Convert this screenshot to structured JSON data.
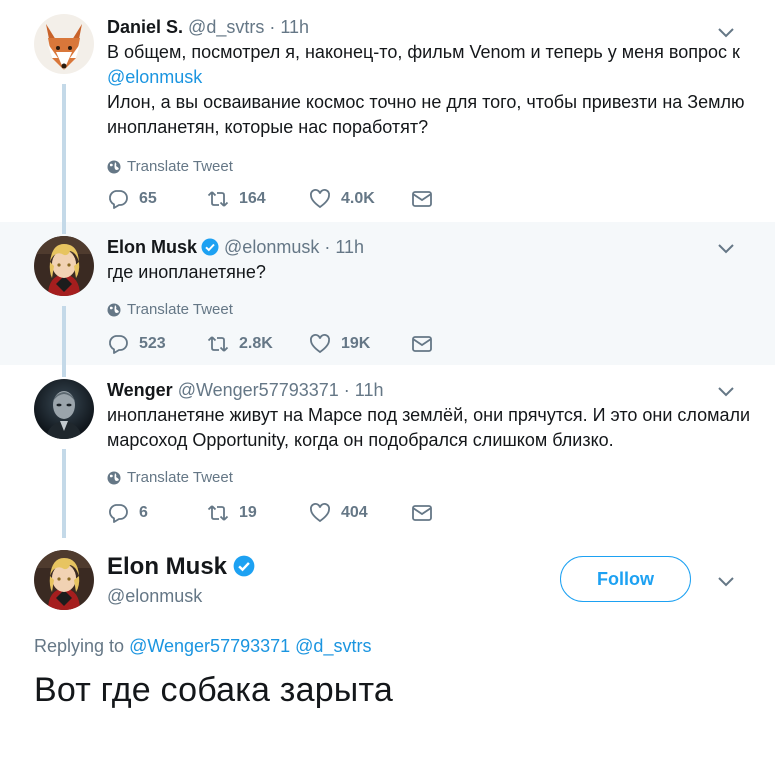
{
  "tweets": [
    {
      "name": "Daniel S.",
      "handle": "@d_svtrs",
      "dot": "·",
      "time": "11h",
      "text_line1": "В общем, посмотрел я, наконец-то, фильм Venom и теперь у меня вопрос к",
      "mention": "@elonmusk",
      "text_line2": "Илон, а вы осваивание космос точно не для того, чтобы привезти на Землю",
      "text_line3": "инопланетян, которые нас поработят?",
      "translate": "Translate Tweet",
      "replies": "65",
      "retweets": "164",
      "likes": "4.0K"
    },
    {
      "name": "Elon Musk",
      "handle": "@elonmusk",
      "dot": "·",
      "time": "11h",
      "text_line1": "где инопланетяне?",
      "translate": "Translate Tweet",
      "replies": "523",
      "retweets": "2.8K",
      "likes": "19K"
    },
    {
      "name": "Wenger",
      "handle": "@Wenger57793371",
      "dot": "·",
      "time": "11h",
      "text_line1": "инопланетяне живут на Марсе под землёй, они прячутся. И это они сломали",
      "text_line2": "марсоход Opportunity, когда он подобрался слишком близко.",
      "translate": "Translate Tweet",
      "replies": "6",
      "retweets": "19",
      "likes": "404"
    }
  ],
  "main": {
    "name": "Elon Musk",
    "handle": "@elonmusk",
    "follow_label": "Follow",
    "replying_prefix": "Replying to",
    "replying_to_1": "@Wenger57793371",
    "replying_to_2": "@d_svtrs",
    "text": "Вот где собака зарыта"
  },
  "colors": {
    "accent": "#1da1f2",
    "link": "#1b95e0",
    "muted": "#657786",
    "highlight_bg": "#f5f8fa",
    "thread_line": "#c4d9e8"
  },
  "icons": [
    "reply-icon",
    "retweet-icon",
    "like-icon",
    "dm-icon",
    "globe-icon",
    "chevron-down-icon",
    "verified-badge-icon"
  ]
}
